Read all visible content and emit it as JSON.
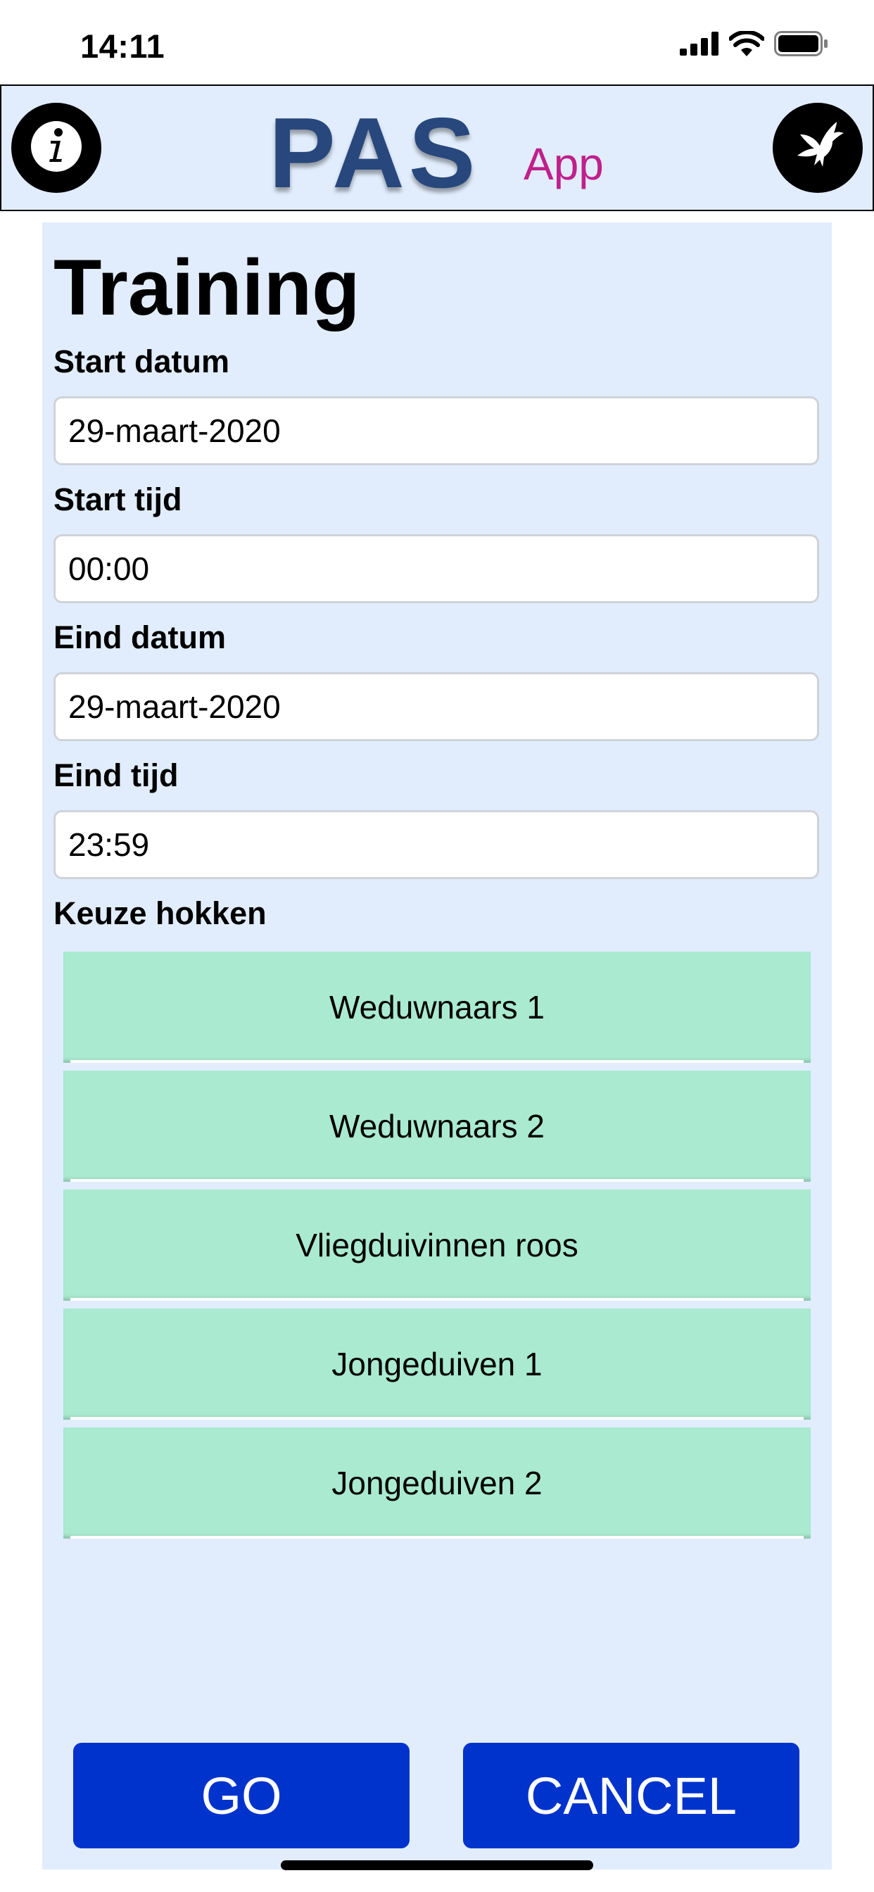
{
  "status_bar": {
    "time": "14:11",
    "icons": [
      "signal-icon",
      "wifi-icon",
      "battery-icon"
    ]
  },
  "header": {
    "logo_main": "PAS",
    "logo_sub": "App",
    "left_icon": "info-icon",
    "right_icon": "dove-icon"
  },
  "form": {
    "title": "Training",
    "start_date_label": "Start datum",
    "start_date_value": "29-maart-2020",
    "start_time_label": "Start tijd",
    "start_time_value": "00:00",
    "end_date_label": "Eind datum",
    "end_date_value": "29-maart-2020",
    "end_time_label": "Eind tijd",
    "end_time_value": "23:59",
    "groups_label": "Keuze hokken",
    "groups": [
      {
        "label": "Weduwnaars 1"
      },
      {
        "label": "Weduwnaars 2"
      },
      {
        "label": "Vliegduivinnen roos"
      },
      {
        "label": "Jongeduiven 1"
      },
      {
        "label": "Jongeduiven 2"
      }
    ]
  },
  "actions": {
    "go_label": "GO",
    "cancel_label": "CANCEL"
  },
  "colors": {
    "panel_bg": "#e1edfc",
    "group_item_bg": "#aaead0",
    "button_bg": "#0033cc",
    "logo_blue": "#28477c",
    "logo_pink": "#c0208c"
  }
}
